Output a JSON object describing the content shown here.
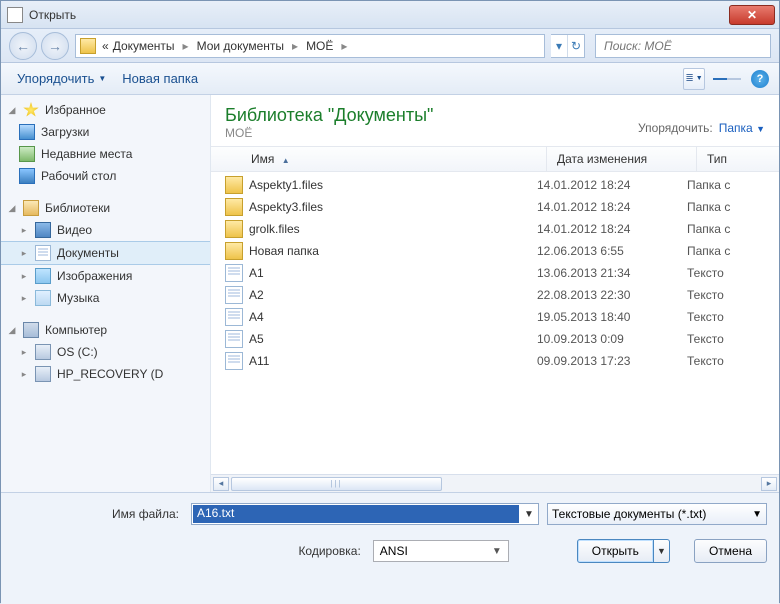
{
  "window": {
    "title": "Открыть"
  },
  "breadcrumb": {
    "prefix": "«",
    "items": [
      "Документы",
      "Мои документы",
      "МОЁ"
    ]
  },
  "search": {
    "placeholder": "Поиск: МОЁ"
  },
  "toolbar": {
    "organize": "Упорядочить",
    "new_folder": "Новая папка"
  },
  "sidebar": {
    "favorites": {
      "label": "Избранное",
      "items": [
        {
          "label": "Загрузки"
        },
        {
          "label": "Недавние места"
        },
        {
          "label": "Рабочий стол"
        }
      ]
    },
    "libraries": {
      "label": "Библиотеки",
      "items": [
        {
          "label": "Видео"
        },
        {
          "label": "Документы",
          "selected": true
        },
        {
          "label": "Изображения"
        },
        {
          "label": "Музыка"
        }
      ]
    },
    "computer": {
      "label": "Компьютер",
      "items": [
        {
          "label": "OS (C:)"
        },
        {
          "label": "HP_RECOVERY (D"
        }
      ]
    }
  },
  "libheader": {
    "title": "Библиотека \"Документы\"",
    "subtitle": "МОЁ",
    "sort_label": "Упорядочить:",
    "sort_value": "Папка"
  },
  "columns": {
    "name": "Имя",
    "date": "Дата изменения",
    "type": "Тип"
  },
  "files": [
    {
      "icon": "folder",
      "name": "Aspekty1.files",
      "date": "14.01.2012 18:24",
      "type": "Папка с"
    },
    {
      "icon": "folder",
      "name": "Aspekty3.files",
      "date": "14.01.2012 18:24",
      "type": "Папка с"
    },
    {
      "icon": "folder",
      "name": "grolk.files",
      "date": "14.01.2012 18:24",
      "type": "Папка с"
    },
    {
      "icon": "folder",
      "name": "Новая папка",
      "date": "12.06.2013 6:55",
      "type": "Папка с"
    },
    {
      "icon": "doc",
      "name": "A1",
      "date": "13.06.2013 21:34",
      "type": "Тексто"
    },
    {
      "icon": "doc",
      "name": "A2",
      "date": "22.08.2013 22:30",
      "type": "Тексто"
    },
    {
      "icon": "doc",
      "name": "A4",
      "date": "19.05.2013 18:40",
      "type": "Тексто"
    },
    {
      "icon": "doc",
      "name": "A5",
      "date": "10.09.2013 0:09",
      "type": "Тексто"
    },
    {
      "icon": "doc",
      "name": "A11",
      "date": "09.09.2013 17:23",
      "type": "Тексто"
    }
  ],
  "form": {
    "filename_label": "Имя файла:",
    "filename_value": "A16.txt",
    "filter_value": "Текстовые документы (*.txt)",
    "encoding_label": "Кодировка:",
    "encoding_value": "ANSI",
    "open_label": "Открыть",
    "cancel_label": "Отмена"
  }
}
